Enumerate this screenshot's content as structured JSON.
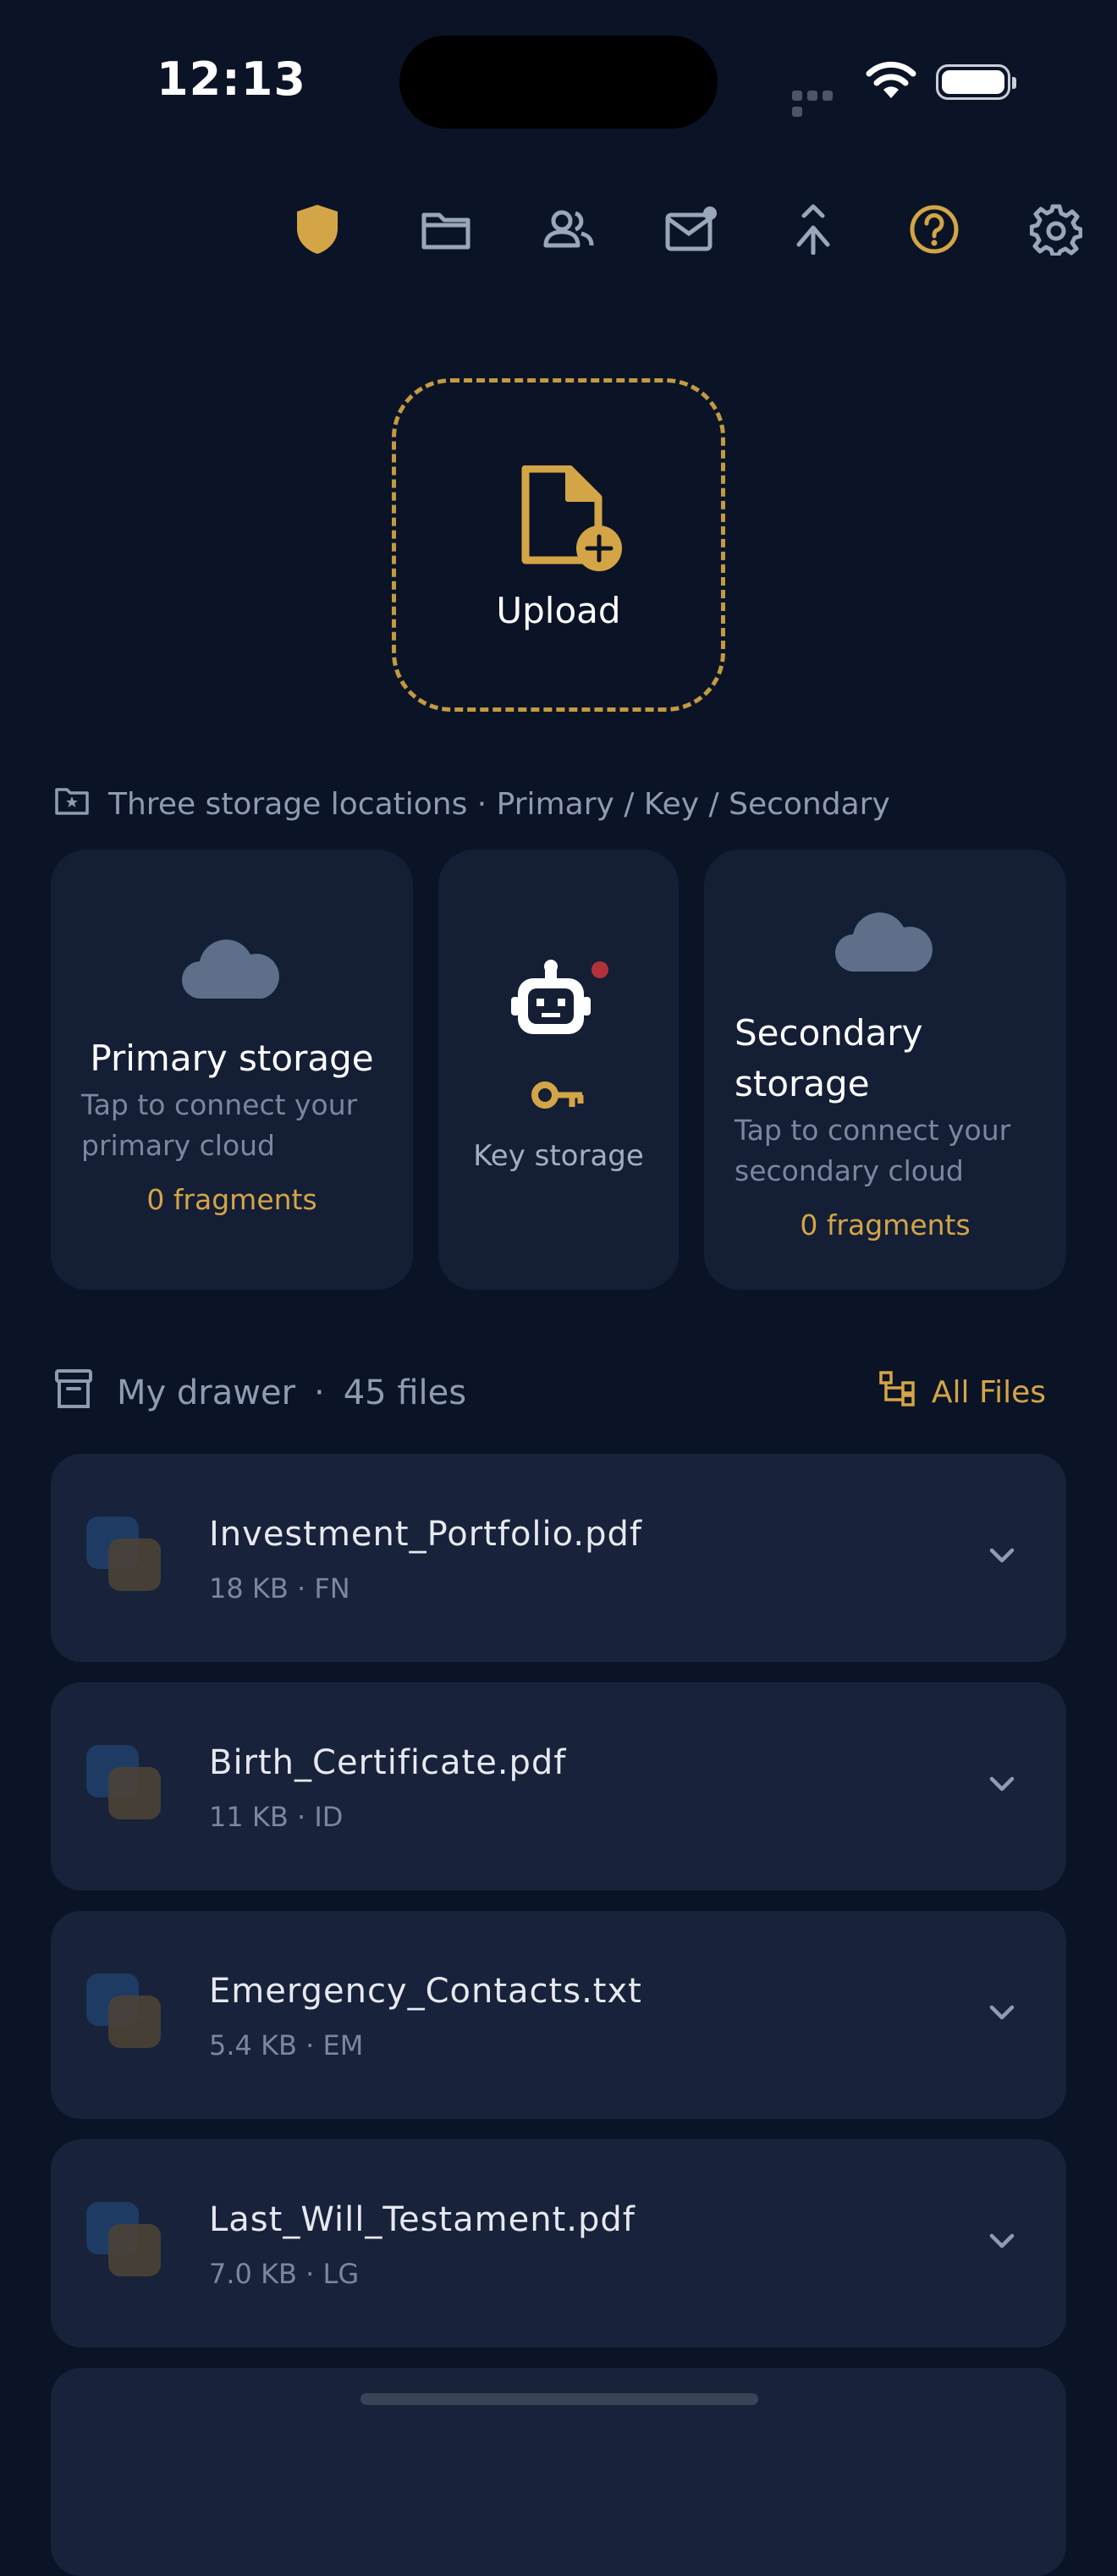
{
  "status_bar": {
    "time": "12:13"
  },
  "nav": {
    "icons": [
      "shield-icon",
      "folder-icon",
      "people-icon",
      "mail-icon",
      "merge-icon",
      "help-icon",
      "gear-icon"
    ]
  },
  "upload": {
    "label": "Upload"
  },
  "storage": {
    "caption": "Three storage locations · Primary / Key / Secondary",
    "primary": {
      "title": "Primary storage",
      "subtitle_line1": "Tap to connect your",
      "subtitle_line2": "primary cloud",
      "fragments": "0 fragments"
    },
    "key": {
      "title": "Key storage"
    },
    "secondary": {
      "title_line1": "Secondary",
      "title_line2": "storage",
      "subtitle_line1": "Tap to connect your",
      "subtitle_line2": "secondary cloud",
      "fragments": "0 fragments"
    }
  },
  "drawer": {
    "title": "My drawer",
    "separator": "·",
    "count": "45 files",
    "all_files_label": "All Files"
  },
  "files": [
    {
      "name": "Investment_Portfolio.pdf",
      "meta": "18 KB · FN"
    },
    {
      "name": "Birth_Certificate.pdf",
      "meta": "11 KB · ID"
    },
    {
      "name": "Emergency_Contacts.txt",
      "meta": "5.4 KB · EM"
    },
    {
      "name": "Last_Will_Testament.pdf",
      "meta": "7.0 KB · LG"
    }
  ],
  "colors": {
    "background": "#0b1426",
    "card": "#141f36",
    "accent": "#d4a547",
    "muted": "#8f9bb1"
  }
}
